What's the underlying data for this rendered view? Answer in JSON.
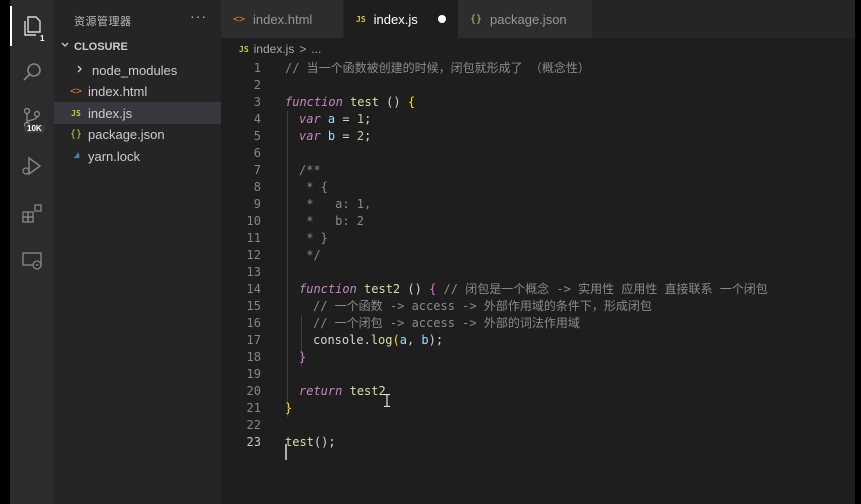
{
  "sidebar": {
    "header": "资源管理器",
    "more": "···",
    "folder": "CLOSURE",
    "items": [
      {
        "label": "node_modules",
        "icon": "chevron-right-icon"
      },
      {
        "label": "index.html",
        "icon": "html-file-icon"
      },
      {
        "label": "index.js",
        "icon": "js-file-icon"
      },
      {
        "label": "package.json",
        "icon": "json-file-icon"
      },
      {
        "label": "yarn.lock",
        "icon": "yarn-icon"
      }
    ]
  },
  "activity": {
    "explorer_badge": "1",
    "scm_badge": "10K"
  },
  "tabs": [
    {
      "label": "index.html",
      "icon": "<>"
    },
    {
      "label": "index.js",
      "icon": "JS"
    },
    {
      "label": "package.json",
      "icon": "{}"
    }
  ],
  "breadcrumb": {
    "file": "index.js",
    "sep": ">",
    "rest": "..."
  },
  "icons": {
    "html": "<>",
    "js": "JS",
    "json": "{}",
    "chev_right": ">",
    "chev_down": "v"
  },
  "code": {
    "line_numbers": [
      "1",
      "2",
      "3",
      "4",
      "5",
      "6",
      "7",
      "8",
      "9",
      "10",
      "11",
      "12",
      "13",
      "14",
      "15",
      "16",
      "17",
      "18",
      "19",
      "20",
      "21",
      "22",
      "23"
    ],
    "l1": "// 当一个函数被创建的时候，闭包就形成了 （概念性）",
    "l3_kw": "function",
    "l3_fn": "test",
    "l3_rest": " () ",
    "l3_brace": "{",
    "l4_kw": "var",
    "l4_var": "a",
    "l4_eq": " = ",
    "l4_num": "1",
    "l4_end": ";",
    "l5_kw": "var",
    "l5_var": "b",
    "l5_eq": " = ",
    "l5_num": "2",
    "l5_end": ";",
    "l7": "/**",
    "l8": " * {",
    "l9": " *   a: 1,",
    "l10": " *   b: 2",
    "l11": " * }",
    "l12": " */",
    "l14_kw": "function",
    "l14_fn": "test2",
    "l14_rest": " () ",
    "l14_brace": "{",
    "l14_com": " // 闭包是一个概念 -> 实用性 应用性 直接联系 一个闭包",
    "l15": "// 一个函数 -> access -> 外部作用域的条件下，形成闭包",
    "l16": "// 一个闭包 -> access -> 外部的词法作用域",
    "l17_obj": "console",
    "l17_dot": ".",
    "l17_fn": "log",
    "l17_p1": "(",
    "l17_a": "a",
    "l17_comma": ", ",
    "l17_b": "b",
    "l17_p2": ");",
    "l18": "}",
    "l20_kw": "return",
    "l20_fn": "test2",
    "l21": "}",
    "l23_fn": "test",
    "l23_rest": "();"
  }
}
